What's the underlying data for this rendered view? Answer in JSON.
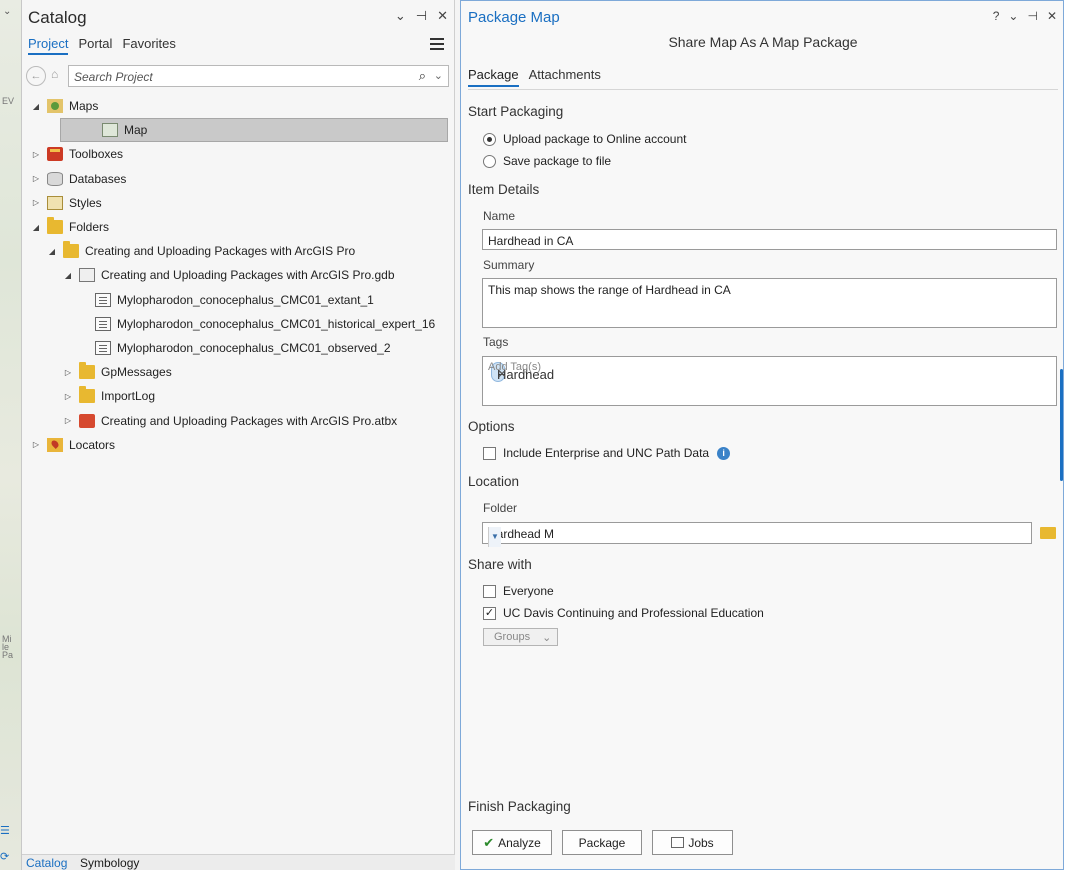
{
  "map_strip": {
    "ticks": [
      "EV",
      "Mi",
      "le",
      "Pa"
    ],
    "collapse_glyph": "⌄"
  },
  "catalog": {
    "title": "Catalog",
    "controls": [
      "⌄",
      "⊣",
      "✕"
    ],
    "tabs": [
      "Project",
      "Portal",
      "Favorites"
    ],
    "active_tab": "Project",
    "search_placeholder": "Search Project",
    "tree": [
      {
        "label": "Maps",
        "icon": "maps-icon",
        "expanded": true
      },
      {
        "label": "Map",
        "icon": "map-icon",
        "selected": true
      },
      {
        "label": "Toolboxes",
        "icon": "toolbox-icon",
        "expanded": false
      },
      {
        "label": "Databases",
        "icon": "database-icon",
        "expanded": false
      },
      {
        "label": "Styles",
        "icon": "styles-icon",
        "expanded": false
      },
      {
        "label": "Folders",
        "icon": "folder-icon",
        "expanded": true
      },
      {
        "label": "Creating and Uploading Packages with ArcGIS Pro",
        "icon": "folder-icon",
        "expanded": true
      },
      {
        "label": "Creating and Uploading Packages with ArcGIS Pro.gdb",
        "icon": "geodatabase-icon",
        "expanded": true
      },
      {
        "label": "Mylopharodon_conocephalus_CMC01_extant_1",
        "icon": "feature-class-icon"
      },
      {
        "label": "Mylopharodon_conocephalus_CMC01_historical_expert_16",
        "icon": "feature-class-icon"
      },
      {
        "label": "Mylopharodon_conocephalus_CMC01_observed_2",
        "icon": "feature-class-icon"
      },
      {
        "label": "GpMessages",
        "icon": "folder-icon",
        "expanded": false
      },
      {
        "label": "ImportLog",
        "icon": "folder-icon",
        "expanded": false
      },
      {
        "label": "Creating and Uploading Packages with ArcGIS Pro.atbx",
        "icon": "toolbox-icon",
        "expanded": false
      },
      {
        "label": "Locators",
        "icon": "locator-icon",
        "expanded": false
      }
    ],
    "bottom_tabs": [
      "Catalog",
      "Symbology"
    ]
  },
  "package": {
    "title": "Package Map",
    "controls": [
      "?",
      "⌄",
      "⊣",
      "✕"
    ],
    "subtitle": "Share Map As A Map Package",
    "tabs": [
      "Package",
      "Attachments"
    ],
    "start_packaging": {
      "heading": "Start Packaging",
      "options": [
        "Upload package to Online account",
        "Save package to file"
      ],
      "selected": 0
    },
    "item_details": {
      "heading": "Item Details",
      "name_label": "Name",
      "name_value": "Hardhead in CA",
      "summary_label": "Summary",
      "summary_value": "This map shows the range of Hardhead in CA",
      "tags_label": "Tags",
      "tags": [
        "Hardhead"
      ],
      "tag_placeholder": "Add Tag(s)"
    },
    "options": {
      "heading": "Options",
      "include_label": "Include Enterprise and UNC Path Data",
      "include_checked": false
    },
    "location": {
      "heading": "Location",
      "folder_label": "Folder",
      "folder_value": "Hardhead M"
    },
    "share_with": {
      "heading": "Share with",
      "everyone": "Everyone",
      "everyone_checked": false,
      "org": "UC Davis Continuing and Professional Education",
      "org_checked": true,
      "groups": "Groups"
    },
    "finish": {
      "heading": "Finish Packaging",
      "analyze": "Analyze",
      "package": "Package",
      "jobs": "Jobs"
    }
  },
  "colors": {
    "accent": "#1a6fc2",
    "tag_bg": "#cfe3f5",
    "selection": "#c9c9c9"
  }
}
